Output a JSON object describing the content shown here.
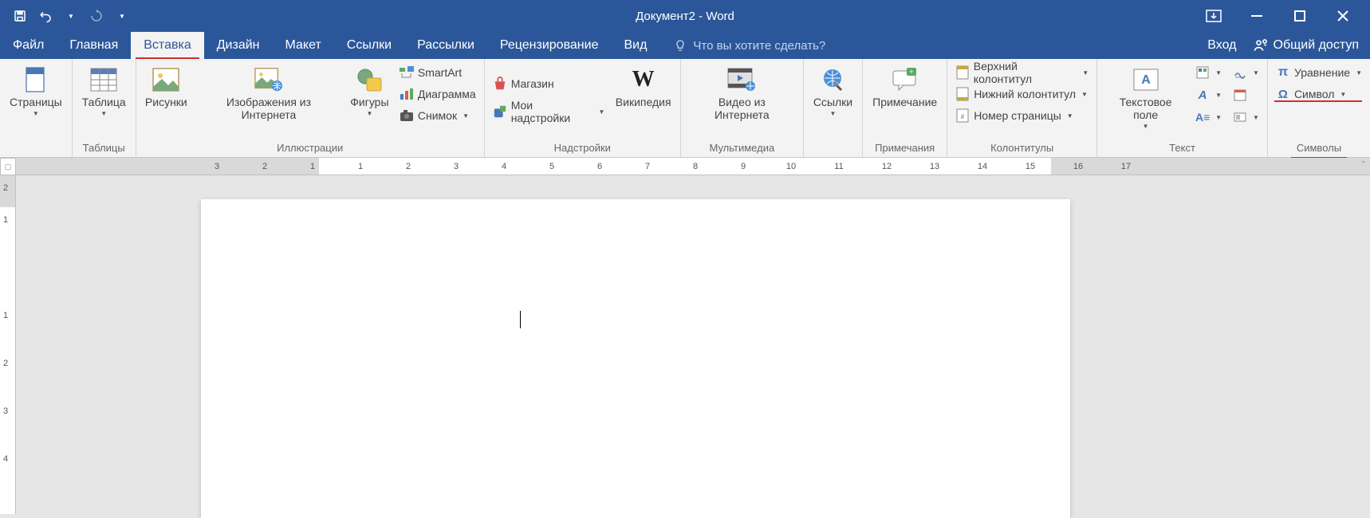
{
  "title": "Документ2 - Word",
  "tabs": {
    "file": "Файл",
    "home": "Главная",
    "insert": "Вставка",
    "design": "Дизайн",
    "layout": "Макет",
    "references": "Ссылки",
    "mailings": "Рассылки",
    "review": "Рецензирование",
    "view": "Вид"
  },
  "activeTab": "insert",
  "tellMe": "Что вы хотите сделать?",
  "signIn": "Вход",
  "share": "Общий доступ",
  "groups": {
    "pages": {
      "title": "",
      "cover": "Страницы"
    },
    "tables": {
      "title": "Таблицы",
      "table": "Таблица"
    },
    "illustrations": {
      "title": "Иллюстрации",
      "pictures": "Рисунки",
      "online_pictures": "Изображения из Интернета",
      "shapes": "Фигуры",
      "smartart": "SmartArt",
      "chart": "Диаграмма",
      "screenshot": "Снимок"
    },
    "addins": {
      "title": "Надстройки",
      "store": "Магазин",
      "my_addins": "Мои надстройки",
      "wikipedia": "Википедия"
    },
    "media": {
      "title": "Мультимедиа",
      "online_video": "Видео из Интернета"
    },
    "links": {
      "title": "",
      "links": "Ссылки"
    },
    "comments": {
      "title": "Примечания",
      "comment": "Примечание"
    },
    "header_footer": {
      "title": "Колонтитулы",
      "header": "Верхний колонтитул",
      "footer": "Нижний колонтитул",
      "page_number": "Номер страницы"
    },
    "text": {
      "title": "Текст",
      "text_box": "Текстовое поле"
    },
    "symbols": {
      "title": "Символы",
      "equation": "Уравнение",
      "symbol": "Символ"
    }
  },
  "ruler": {
    "left_gray_numbers": [
      "3",
      "2",
      "1"
    ],
    "white_numbers": [
      "1",
      "2",
      "3",
      "4",
      "5",
      "6",
      "7",
      "8",
      "9",
      "10",
      "11",
      "12",
      "13",
      "14",
      "15",
      "16"
    ],
    "right_gray_numbers": [
      "17"
    ]
  },
  "v_ruler": [
    "2",
    "1",
    "1",
    "2",
    "3",
    "4"
  ]
}
